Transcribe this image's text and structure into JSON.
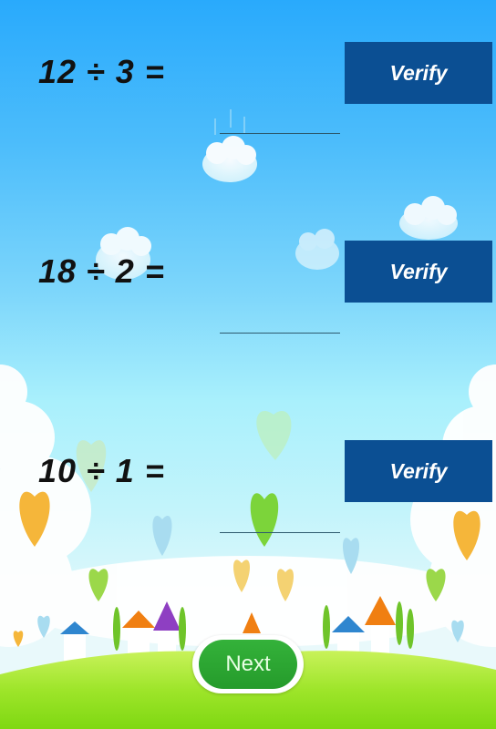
{
  "problems": [
    {
      "expression": "12 ÷ 3 =",
      "answer_value": "",
      "verify_label": "Verify"
    },
    {
      "expression": "18 ÷ 2 =",
      "answer_value": "",
      "verify_label": "Verify"
    },
    {
      "expression": "10 ÷ 1 =",
      "answer_value": "",
      "verify_label": "Verify"
    }
  ],
  "footer": {
    "next_label": "Next"
  },
  "colors": {
    "verify_button": "#0b4f93",
    "next_button": "#2ea834",
    "sky_top": "#29aafc",
    "grass": "#8ee01a"
  },
  "background": {
    "scene": "sky-clouds-heart-balloons-village-meadow"
  }
}
